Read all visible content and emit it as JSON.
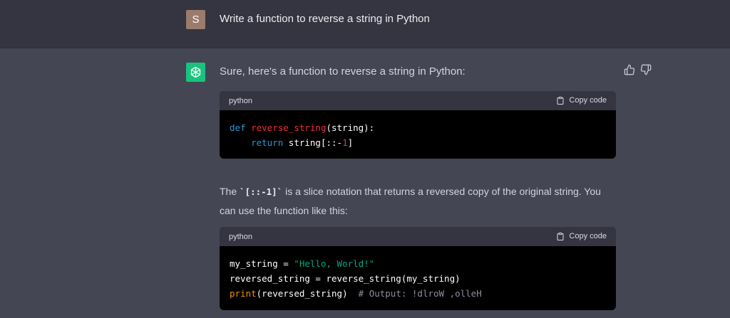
{
  "user": {
    "avatar_letter": "S",
    "message": "Write a function to reverse a string in Python"
  },
  "assistant": {
    "intro": "Sure, here's a function to reverse a string in Python:",
    "feedback_icons": [
      "thumbs-up-icon",
      "thumbs-down-icon"
    ],
    "code_blocks": [
      {
        "language": "python",
        "copy_label": "Copy code",
        "lines": [
          "def reverse_string(string):",
          "    return string[::-1]"
        ]
      },
      {
        "language": "python",
        "copy_label": "Copy code",
        "lines": [
          "my_string = \"Hello, World!\"",
          "reversed_string = reverse_string(my_string)",
          "print(reversed_string)  # Output: !dlroW ,olleH"
        ]
      }
    ],
    "paragraph": {
      "before": "The ",
      "code": "`[::-1]`",
      "after": " is a slice notation that returns a reversed copy of the original string. You can use the function like this:"
    }
  },
  "colors": {
    "user_bg": "#343541",
    "assistant_bg": "#444654",
    "bot_avatar": "#19c37d",
    "user_avatar": "#9b7b6b",
    "keyword": "#2e95d3",
    "function_name": "#f22c3d",
    "number": "#df3079",
    "string": "#00a67d",
    "builtin": "#e9950c",
    "comment": "#8e8ea0"
  }
}
